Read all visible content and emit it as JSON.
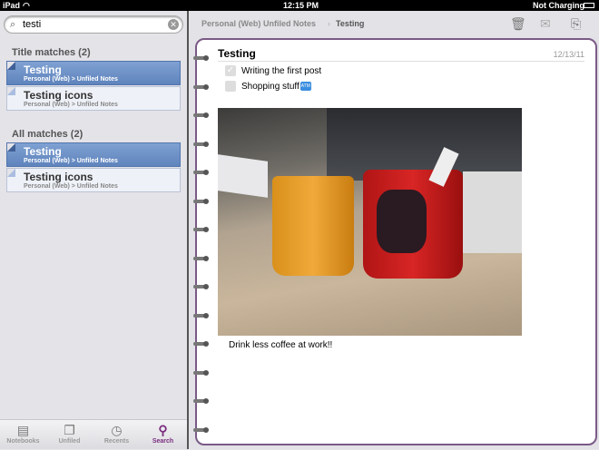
{
  "status": {
    "device": "iPad",
    "time": "12:15 PM",
    "battery": "Not Charging"
  },
  "search": {
    "value": "testi"
  },
  "title_matches": {
    "label": "Title matches (2)",
    "items": [
      {
        "title": "Testing",
        "path": "Personal (Web) > Unfiled Notes"
      },
      {
        "title": "Testing icons",
        "path": "Personal (Web) > Unfiled Notes"
      }
    ]
  },
  "all_matches": {
    "label": "All matches (2)",
    "items": [
      {
        "title": "Testing",
        "path": "Personal (Web) > Unfiled Notes"
      },
      {
        "title": "Testing icons",
        "path": "Personal (Web) > Unfiled Notes"
      }
    ]
  },
  "tabs": [
    {
      "label": "Notebooks"
    },
    {
      "label": "Unfiled"
    },
    {
      "label": "Recents"
    },
    {
      "label": "Search"
    }
  ],
  "breadcrumb": [
    "Personal (Web)",
    "Unfiled Notes",
    "Testing"
  ],
  "note": {
    "title": "Testing",
    "date": "12/13/11",
    "checklist": [
      {
        "text": "Writing the first post",
        "checked": true
      },
      {
        "text": "Shopping stuff",
        "checked": false
      }
    ],
    "emoji": "ATM",
    "caption": "Drink less coffee at work!!"
  },
  "colors": {
    "accent": "#7a2c7e",
    "selected": "#6b8fc7"
  }
}
